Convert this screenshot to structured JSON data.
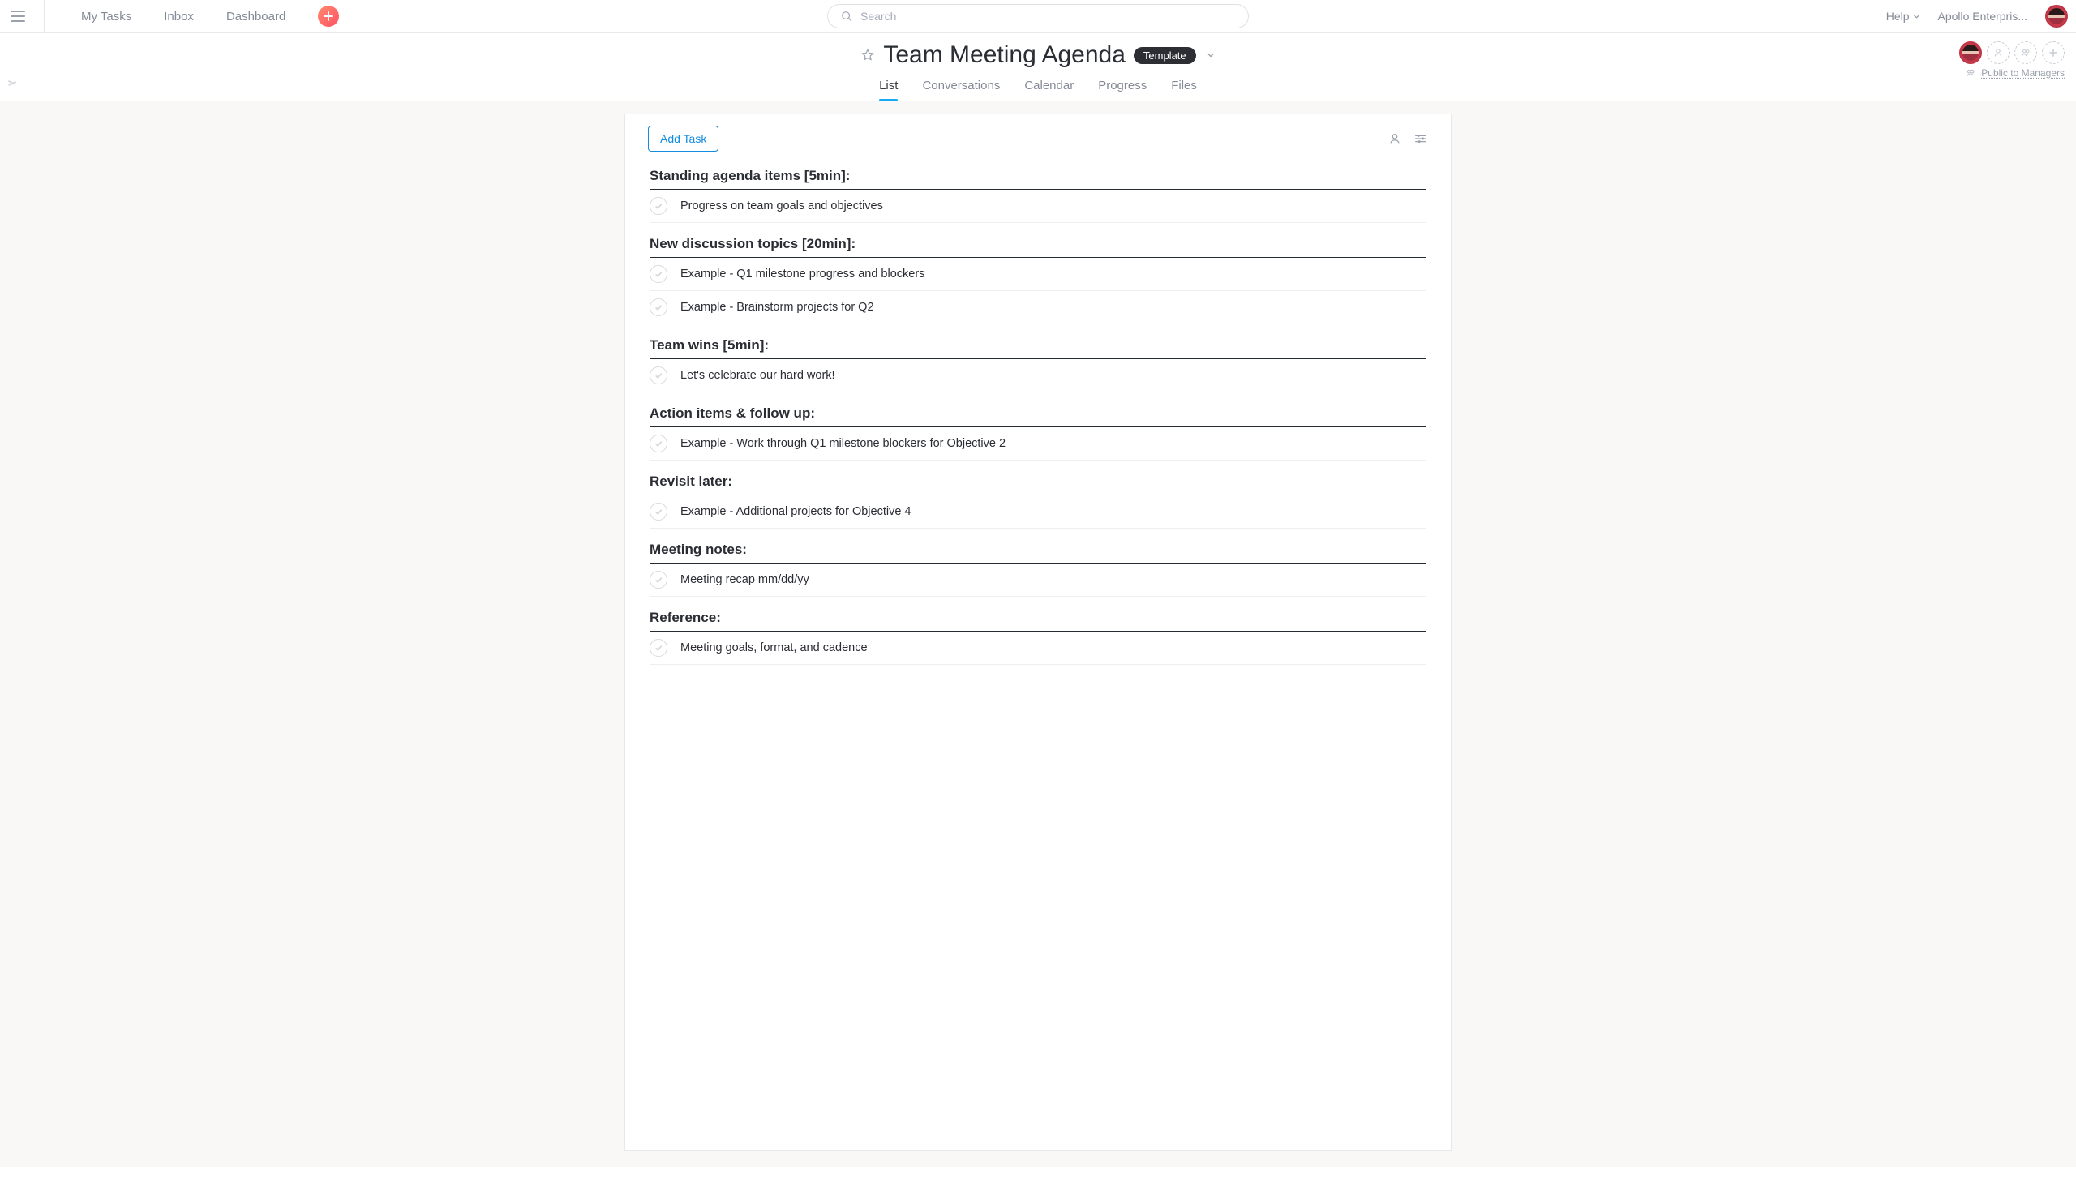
{
  "topnav": {
    "my_tasks": "My Tasks",
    "inbox": "Inbox",
    "dashboard": "Dashboard",
    "search_placeholder": "Search",
    "help": "Help",
    "org": "Apollo Enterpris..."
  },
  "project": {
    "title": "Team Meeting Agenda",
    "badge": "Template",
    "privacy": "Public to Managers",
    "tabs": [
      {
        "label": "List",
        "active": true
      },
      {
        "label": "Conversations",
        "active": false
      },
      {
        "label": "Calendar",
        "active": false
      },
      {
        "label": "Progress",
        "active": false
      },
      {
        "label": "Files",
        "active": false
      }
    ]
  },
  "toolbar": {
    "add_task": "Add Task"
  },
  "sections": [
    {
      "title": "Standing agenda items [5min]:",
      "tasks": [
        "Progress on team goals and objectives"
      ]
    },
    {
      "title": "New discussion topics [20min]:",
      "tasks": [
        "Example - Q1 milestone progress and blockers",
        "Example - Brainstorm projects for Q2"
      ]
    },
    {
      "title": "Team wins [5min]:",
      "tasks": [
        "Let's celebrate our hard work!"
      ]
    },
    {
      "title": "Action items & follow up:",
      "tasks": [
        "Example - Work through Q1 milestone blockers for Objective 2"
      ]
    },
    {
      "title": "Revisit later:",
      "tasks": [
        "Example - Additional projects for Objective 4"
      ]
    },
    {
      "title": "Meeting notes:",
      "tasks": [
        "Meeting recap mm/dd/yy"
      ]
    },
    {
      "title": "Reference:",
      "tasks": [
        "Meeting goals, format, and cadence"
      ]
    }
  ]
}
